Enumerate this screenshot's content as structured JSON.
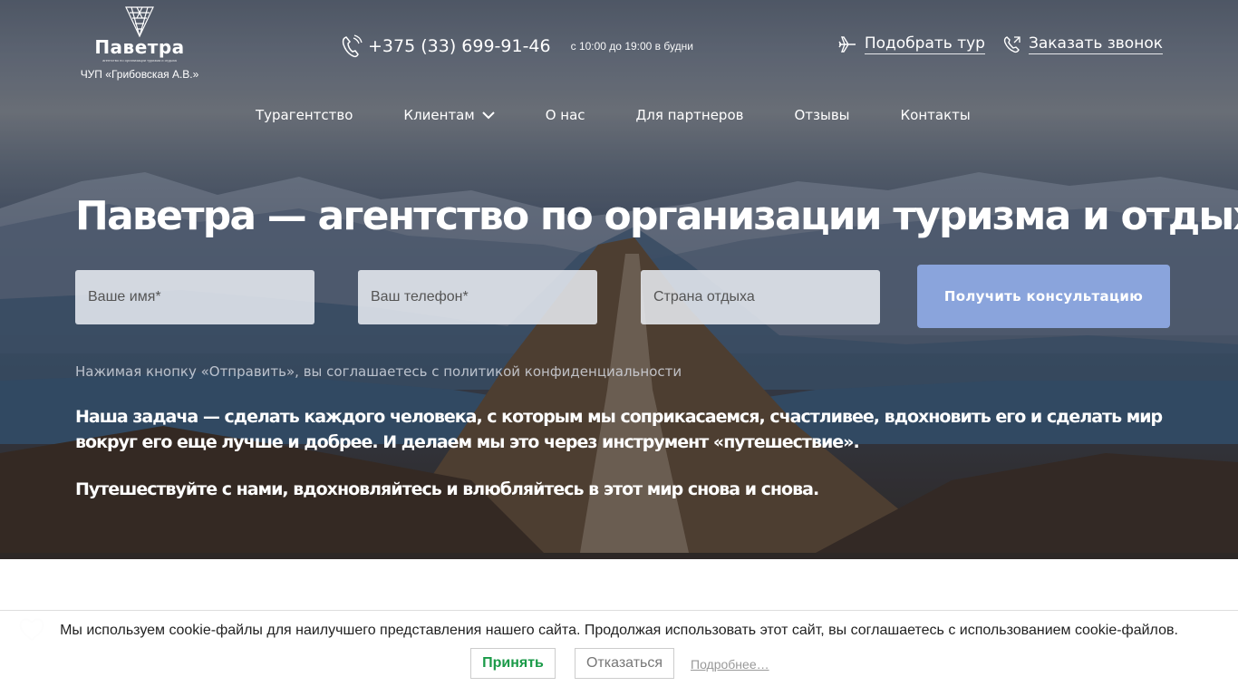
{
  "header": {
    "brand": "Паветра",
    "tagline": "агентство по организации туризма и отдыха",
    "company": "ЧУП «Грибовская А.В.»",
    "phone": "+375 (33) 699-91-46",
    "hours": "с 10:00 до 19:00 в будни",
    "pick_tour": "Подобрать тур",
    "order_call": "Заказать звонок"
  },
  "nav": {
    "items": [
      "Турагентство",
      "Клиентам",
      "О нас",
      "Для партнеров",
      "Отзывы",
      "Контакты"
    ]
  },
  "hero": {
    "title": "Паветра — агентство по организации туризма и отдыха",
    "name_placeholder": "Ваше имя*",
    "phone_placeholder": "Ваш телефон*",
    "country_placeholder": "Страна отдыха",
    "submit": "Получить консультацию",
    "policy": "Нажимая кнопку «Отправить», вы соглашаетесь с политикой конфиденциальности",
    "mission": "Наша задача — сделать каждого человека, с которым мы соприкасаемся, счастливее, вдохновить его и сделать мир вокруг его еще лучше и добрее. И делаем мы это через инструмент «путешествие».",
    "mission2": "Путешествуйте с нами, вдохновляйтесь и влюбляйтесь в этот мир снова и снова."
  },
  "cookie": {
    "message": "Мы используем cookie-файлы для наилучшего представления нашего сайта. Продолжая использовать этот сайт, вы соглашаетесь с использованием cookie-файлов.",
    "accept": "Принять",
    "decline": "Отказаться",
    "more": "Подробнее…"
  },
  "colors": {
    "accent_button": "#8aa4dc",
    "accept_text": "#1a9a48"
  }
}
